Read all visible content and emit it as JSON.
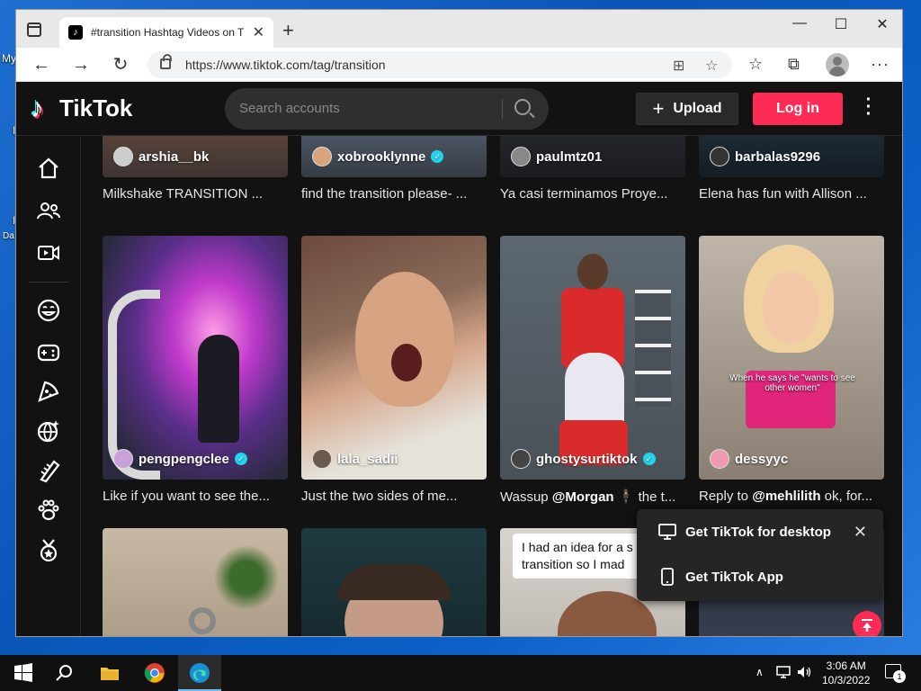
{
  "desktop": {
    "label_my": "My",
    "label_da": "Da"
  },
  "browser": {
    "tab_title": "#transition Hashtag Videos on TikTok",
    "tab_favicon": "tiktok-icon",
    "url": "https://www.tiktok.com/tag/transition",
    "win_min": "—",
    "win_max": "☐",
    "win_close": "✕"
  },
  "tiktok": {
    "logo_text": "TikTok",
    "search_placeholder": "Search accounts",
    "upload_label": "Upload",
    "login_label": "Log in",
    "accent": "#fe2c55",
    "verified_color": "#20d5ec"
  },
  "videos": [
    {
      "user": "arshia__bk",
      "verified": false,
      "caption": "Milkshake TRANSITION ..."
    },
    {
      "user": "xobrooklynne",
      "verified": true,
      "caption": "find the transition please- ..."
    },
    {
      "user": "paulmtz01",
      "verified": false,
      "caption": "Ya casi terminamos Proye..."
    },
    {
      "user": "barbalas9296",
      "verified": false,
      "caption": "Elena has fun with Allison ..."
    },
    {
      "user": "pengpengclee",
      "verified": true,
      "caption": "Like if you want to see the..."
    },
    {
      "user": "lala_sadii",
      "verified": false,
      "caption": "Just the two sides of me..."
    },
    {
      "user": "ghostysurtiktok",
      "verified": true,
      "caption_pre": "Wassup ",
      "caption_mention": "@Morgan",
      "caption_post": " 🕴 the t..."
    },
    {
      "user": "dessyyc",
      "verified": false,
      "caption_pre": "Reply to ",
      "caption_mention": "@mehlilith",
      "caption_post": " ok, for..."
    }
  ],
  "overlays": {
    "dessyyc_text": "When he says he \"wants to see other women\"",
    "note_text": "I had an idea for a s transition so I mad"
  },
  "popup": {
    "desktop_label": "Get TikTok for desktop",
    "app_label": "Get TikTok App"
  },
  "taskbar": {
    "time": "3:06 AM",
    "date": "10/3/2022",
    "notif_count": "1"
  }
}
